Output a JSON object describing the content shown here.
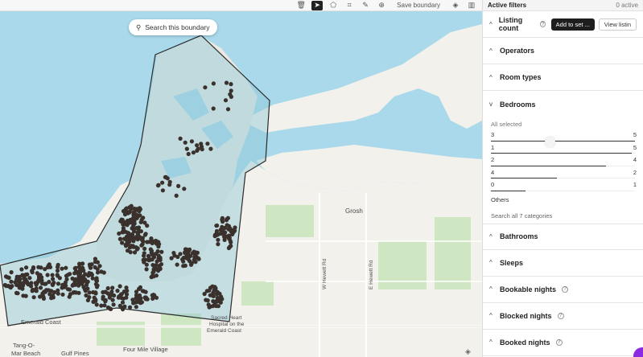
{
  "toolbar": {
    "save_boundary_label": "Save boundary",
    "icons": [
      "trash-icon",
      "cursor-icon",
      "polygon-icon",
      "crop-icon",
      "pen-icon",
      "add-circle-icon",
      "layers-icon",
      "map-icon"
    ]
  },
  "map": {
    "search_pill_label": "Search this boundary",
    "labels": {
      "grosh": "Grosh",
      "emerald_coast": "Emerald Coast",
      "tang_o_mar_beach_line1": "Tang-O-",
      "tang_o_mar_beach_line2": "Mar Beach",
      "gulf_pines": "Gulf Pines",
      "four_mile_village": "Four Mile Village",
      "sacred_heart_line1": "Sacred Heart",
      "sacred_heart_line2": "Hospital on the",
      "sacred_heart_line3": "Emerald Coast",
      "w_hewett_rd": "W Hewett Rd",
      "e_hewett_rd": "E Hewett Rd"
    },
    "colors": {
      "water": "#a9d9ea",
      "land": "#f3f1ec",
      "park": "#cfe6c3",
      "boundary_fill": "#8fc7d6",
      "dots": "#3a302c"
    }
  },
  "panel": {
    "header_title": "Active filters",
    "header_count": "0 active",
    "sections": {
      "listing_count": {
        "label": "Listing count",
        "add_button": "Add to set ...",
        "view_button": "View listin"
      },
      "operators": "Operators",
      "room_types": "Room types",
      "bedrooms": "Bedrooms",
      "bathrooms": "Bathrooms",
      "sleeps": "Sleeps",
      "bookable_nights": "Bookable nights",
      "blocked_nights": "Blocked nights",
      "booked_nights": "Booked nights"
    },
    "bedrooms": {
      "all_selected": "All selected",
      "rows": [
        {
          "key": "3",
          "value": "5",
          "fraction": 1.0
        },
        {
          "key": "1",
          "value": "5",
          "fraction": 0.98
        },
        {
          "key": "2",
          "value": "4",
          "fraction": 0.8
        },
        {
          "key": "4",
          "value": "2",
          "fraction": 0.46
        },
        {
          "key": "0",
          "value": "1",
          "fraction": 0.24
        }
      ],
      "others": "Others",
      "search_all": "Search all 7 categories"
    }
  }
}
